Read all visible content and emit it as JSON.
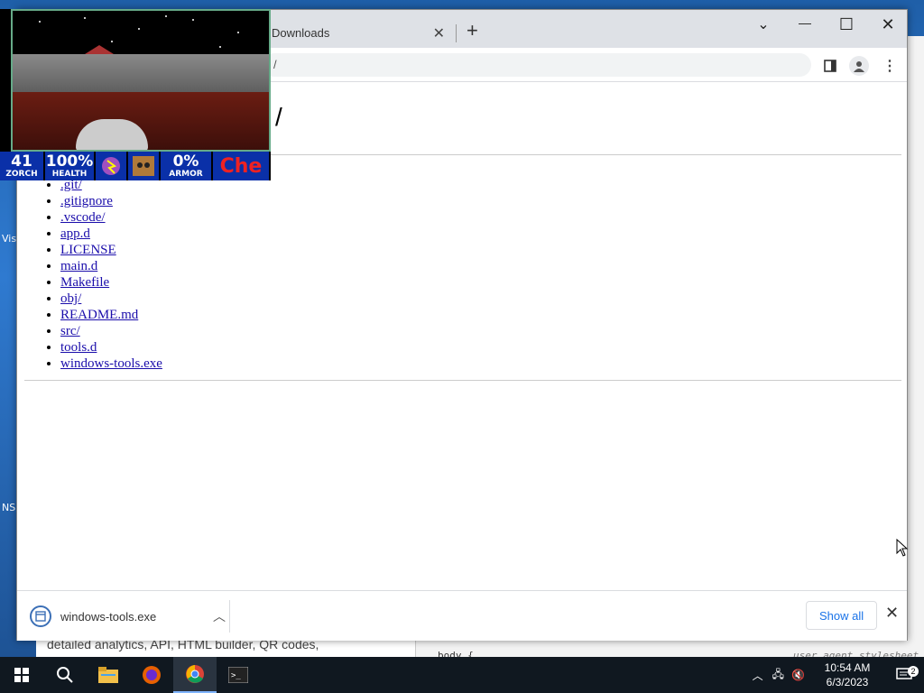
{
  "browser": {
    "tab_title": "Downloads",
    "omnibox_text": "/",
    "page_heading": "/",
    "listing": [
      ".git/",
      ".gitignore",
      ".vscode/",
      "app.d",
      "LICENSE",
      "main.d",
      "Makefile",
      "obj/",
      "README.md",
      "src/",
      "tools.d",
      "windows-tools.exe"
    ],
    "controls": {
      "chevron": "⌄",
      "minimize": "—",
      "maximize": "☐",
      "close": "✕",
      "newtab": "+"
    }
  },
  "downloads": {
    "file_name": "windows-tools.exe",
    "show_all_label": "Show all"
  },
  "game": {
    "hud": [
      {
        "value": "41",
        "label": "ZORCH"
      },
      {
        "value": "100%",
        "label": "HEALTH"
      },
      {
        "value": "",
        "label": ""
      },
      {
        "value": "",
        "label": ""
      },
      {
        "value": "0%",
        "label": "ARMOR"
      },
      {
        "value": "Che",
        "label": ""
      }
    ]
  },
  "background": {
    "left_text": "detailed analytics, API, HTML builder, QR codes,",
    "right_text_1": "body {",
    "right_text_2": "user agent stylesheet",
    "desk_labels": [
      "Vis",
      "NS"
    ]
  },
  "taskbar": {
    "time": "10:54 AM",
    "date": "6/3/2023",
    "notification_count": "2"
  },
  "colors": {
    "accent": "#1a73e8",
    "link": "#1a0dab",
    "hud_bg": "#0a30a8"
  }
}
